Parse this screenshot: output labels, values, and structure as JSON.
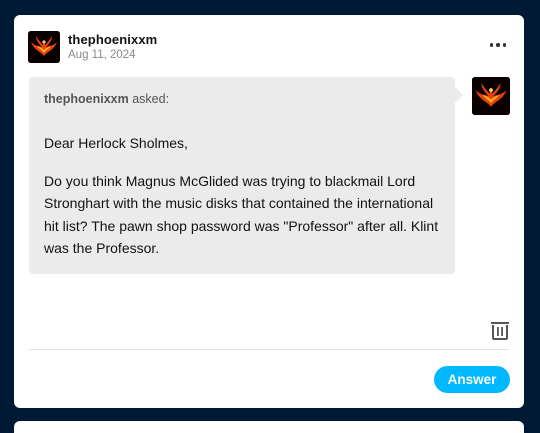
{
  "post": {
    "blog_name": "thephoenixxm",
    "date": "Aug 11, 2024",
    "menu_icon": "more-horizontal-icon",
    "avatar_icon": "phoenix-avatar"
  },
  "ask": {
    "asker_name": "thephoenixxm",
    "asked_label": "asked:",
    "paragraphs": [
      "Dear Herlock Sholmes,",
      "Do you think Magnus McGlided was trying to blackmail Lord Stronghart with the music disks that contained the international hit list? The pawn shop password was \"Professor\" after all. Klint was the Professor."
    ]
  },
  "actions": {
    "delete_icon": "trash-icon",
    "answer_label": "Answer"
  },
  "colors": {
    "background": "#001935",
    "card": "#ffffff",
    "bubble": "#ebebeb",
    "accent": "#00b8ff"
  }
}
